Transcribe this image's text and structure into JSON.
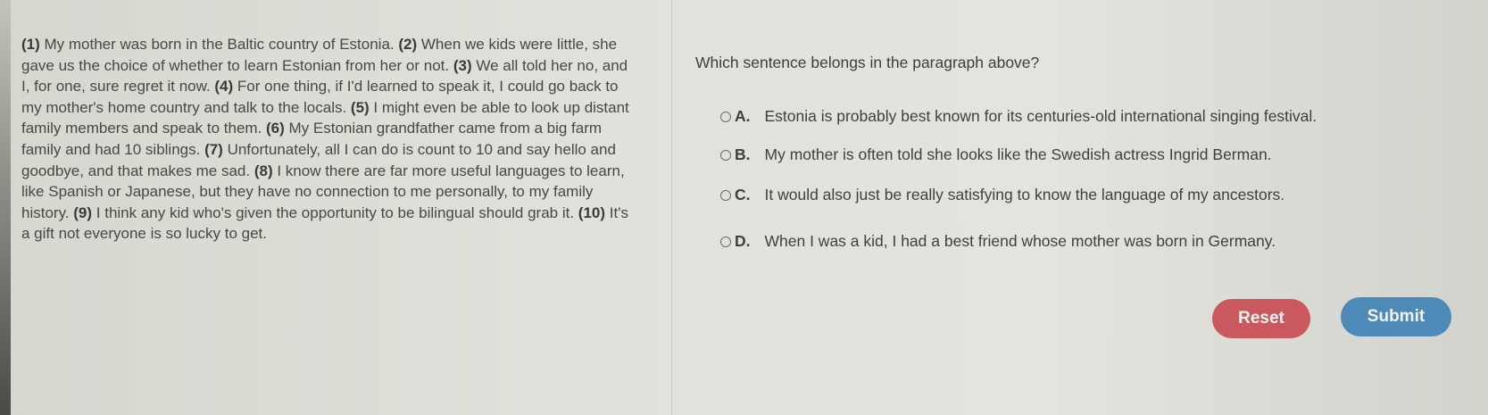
{
  "passage": [
    {
      "num": "(1)",
      "text": " My mother was born in the Baltic country of Estonia. "
    },
    {
      "num": "(2)",
      "text": " When we kids were little, she gave us the choice of whether to learn Estonian from her or not. "
    },
    {
      "num": "(3)",
      "text": " We all told her no, and I, for one, sure regret it now. "
    },
    {
      "num": "(4)",
      "text": " For one thing, if I'd learned to speak it, I could go back to my mother's home country and talk to the locals. "
    },
    {
      "num": "(5)",
      "text": " I might even be able to look up distant family members and speak to them. "
    },
    {
      "num": "(6)",
      "text": " My Estonian grandfather came from a big farm family and had 10 siblings. "
    },
    {
      "num": "(7)",
      "text": " Unfortunately, all I can do is count to 10 and say hello and goodbye, and that makes me sad. "
    },
    {
      "num": "(8)",
      "text": " I know there are far more useful languages to learn, like Spanish or Japanese, but they have no connection to me personally, to my family history. "
    },
    {
      "num": "(9)",
      "text": " I think any kid who's given the opportunity to be bilingual should grab it. "
    },
    {
      "num": "(10)",
      "text": " It's a gift not everyone is so lucky to get."
    }
  ],
  "question": "Which sentence belongs in the paragraph above?",
  "choices": [
    {
      "letter": "A.",
      "text": "Estonia is probably best known for its centuries-old international singing festival."
    },
    {
      "letter": "B.",
      "text": "My mother is often told she looks like the Swedish actress Ingrid Berman."
    },
    {
      "letter": "C.",
      "text": "It would also just be really satisfying to know the language of my ancestors."
    },
    {
      "letter": "D.",
      "text": "When I was a kid, I had a best friend whose mother was born in Germany."
    }
  ],
  "buttons": {
    "reset": "Reset",
    "submit": "Submit"
  },
  "colors": {
    "reset": "#c9595f",
    "submit": "#4d8ab7"
  }
}
